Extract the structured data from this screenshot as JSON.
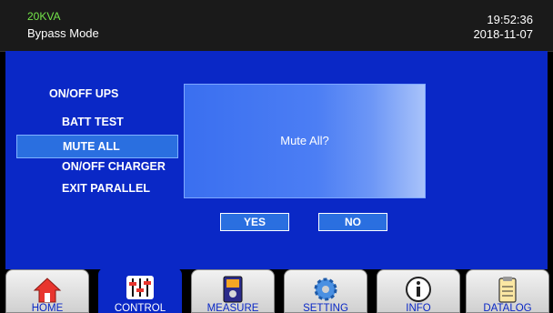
{
  "header": {
    "model": "20KVA",
    "mode": "Bypass Mode",
    "time": "19:52:36",
    "date": "2018-11-07"
  },
  "menu": {
    "items": [
      {
        "label": "ON/OFF UPS"
      },
      {
        "label": "BATT TEST"
      },
      {
        "label": "MUTE ALL",
        "selected": true
      },
      {
        "label": "ON/OFF CHARGER"
      },
      {
        "label": "EXIT PARALLEL"
      }
    ]
  },
  "dialog": {
    "message": "Mute All?",
    "yes_label": "YES",
    "no_label": "NO"
  },
  "tabs": [
    {
      "label": "HOME",
      "icon": "home-icon"
    },
    {
      "label": "CONTROL",
      "icon": "sliders-icon",
      "active": true
    },
    {
      "label": "MEASURE",
      "icon": "meter-icon"
    },
    {
      "label": "SETTING",
      "icon": "gear-icon"
    },
    {
      "label": "INFO",
      "icon": "info-icon"
    },
    {
      "label": "DATALOG",
      "icon": "clipboard-icon"
    }
  ],
  "colors": {
    "panel_blue": "#0a28c6",
    "highlight_blue": "#2a6fe0",
    "model_green": "#74e64a",
    "header_bg": "#1a1a1a"
  }
}
